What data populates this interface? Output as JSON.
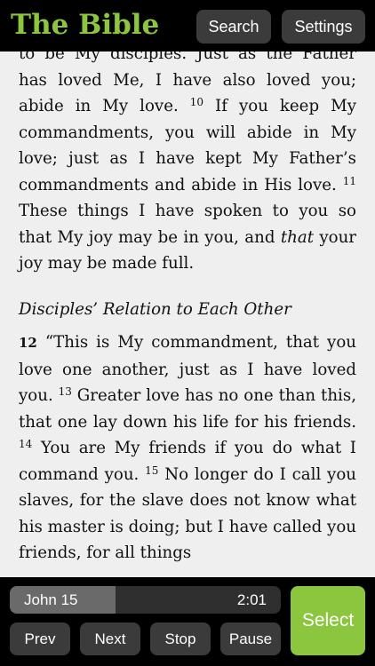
{
  "header": {
    "title": "The Bible",
    "search_label": "Search",
    "settings_label": "Settings"
  },
  "passage": {
    "p1": {
      "t0": "to be My disciples. ",
      "t0b": "Just as the Father has loved Me, I have also loved you; abide in My love. ",
      "v10": "10",
      "t1": " If you keep My commandments, you will abide in My love; just as I have kept My Father’s commandments and abide in His love. ",
      "v11": "11",
      "t2": " These things I have spoken to you so that My joy may be in you, and ",
      "t2i": "that",
      "t3": " your joy may be made full."
    },
    "heading": "Disciples’ Relation to Each Other",
    "p2": {
      "v12": "12",
      "t0": " “This is My commandment, that you love one another, just as I have loved you. ",
      "v13": "13",
      "t1": " Greater love has no one than this, that one lay down his life for his friends. ",
      "v14": "14",
      "t2": " You are My friends if you do what I command you. ",
      "v15": "15",
      "t3": " No longer do I call you slaves, for the slave does not know what his master is doing; but I have called you friends, for all things"
    }
  },
  "player": {
    "chapter": "John 15",
    "time": "2:01",
    "progress": 0.39,
    "prev_label": "Prev",
    "next_label": "Next",
    "stop_label": "Stop",
    "pause_label": "Pause",
    "select_label": "Select"
  },
  "colors": {
    "accent": "#8cc63f",
    "button": "#3b3b3b",
    "page_background": "#efefef"
  }
}
